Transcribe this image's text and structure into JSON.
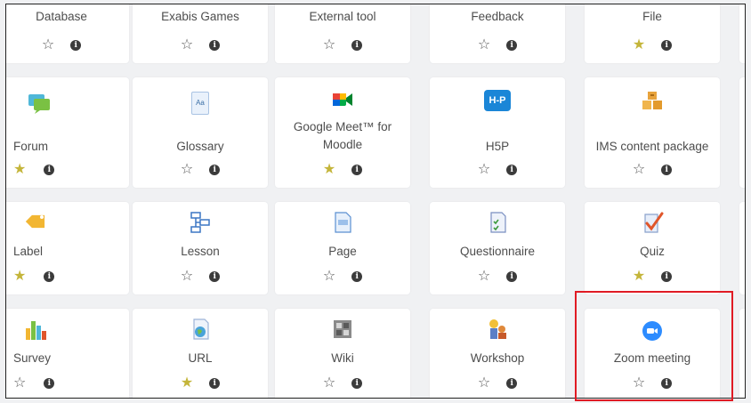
{
  "rows": [
    {
      "cards": [
        {
          "name": "Database",
          "icon": "database-icon",
          "favourite": false
        },
        {
          "name": "Exabis Games",
          "icon": "exabis-games-icon",
          "favourite": false
        },
        {
          "name": "External tool",
          "icon": "external-tool-icon",
          "favourite": false
        },
        {
          "name": "Feedback",
          "icon": "feedback-icon",
          "favourite": false
        },
        {
          "name": "File",
          "icon": "file-icon",
          "favourite": true
        }
      ]
    },
    {
      "cards": [
        {
          "name": "Forum",
          "icon": "forum-icon",
          "favourite": true
        },
        {
          "name": "Glossary",
          "icon": "glossary-icon",
          "favourite": false
        },
        {
          "name": "Google Meet™ for Moodle",
          "icon": "google-meet-icon",
          "favourite": true
        },
        {
          "name": "H5P",
          "icon": "h5p-icon",
          "favourite": false
        },
        {
          "name": "IMS content package",
          "icon": "ims-package-icon",
          "favourite": false
        }
      ]
    },
    {
      "cards": [
        {
          "name": "Label",
          "icon": "label-icon",
          "favourite": true
        },
        {
          "name": "Lesson",
          "icon": "lesson-icon",
          "favourite": false
        },
        {
          "name": "Page",
          "icon": "page-icon",
          "favourite": false
        },
        {
          "name": "Questionnaire",
          "icon": "questionnaire-icon",
          "favourite": false
        },
        {
          "name": "Quiz",
          "icon": "quiz-icon",
          "favourite": true
        }
      ]
    },
    {
      "cards": [
        {
          "name": "Survey",
          "icon": "survey-icon",
          "favourite": false
        },
        {
          "name": "URL",
          "icon": "url-icon",
          "favourite": true
        },
        {
          "name": "Wiki",
          "icon": "wiki-icon",
          "favourite": false
        },
        {
          "name": "Workshop",
          "icon": "workshop-icon",
          "favourite": false
        },
        {
          "name": "Zoom meeting",
          "icon": "zoom-icon",
          "favourite": false
        }
      ]
    }
  ],
  "h5p_icon_text": "H-P",
  "glossary_icon_text": "Aa",
  "glyphs": {
    "star_empty": "☆",
    "star_filled": "★",
    "info": "i"
  },
  "colors": {
    "favourite_star": "#c4b53a",
    "highlight_border": "#e01b24",
    "h5p_blue": "#1b86d7",
    "zoom_blue": "#2d8cff"
  }
}
